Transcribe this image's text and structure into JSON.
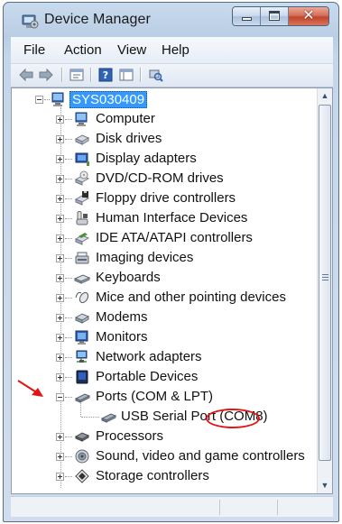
{
  "window": {
    "title": "Device Manager",
    "close_glyph": "✕"
  },
  "menu": [
    "File",
    "Action",
    "View",
    "Help"
  ],
  "toolbar": {
    "icons": [
      "back-icon",
      "forward-icon",
      "properties-icon",
      "help-icon",
      "show-hidden-icon",
      "scan-hardware-icon"
    ]
  },
  "tree": {
    "root": "SYS030409",
    "categories": [
      "Computer",
      "Disk drives",
      "Display adapters",
      "DVD/CD-ROM drives",
      "Floppy drive controllers",
      "Human Interface Devices",
      "IDE ATA/ATAPI controllers",
      "Imaging devices",
      "Keyboards",
      "Mice and other pointing devices",
      "Modems",
      "Monitors",
      "Network adapters",
      "Portable Devices",
      "Ports (COM & LPT)",
      "USB Serial Port (COM8)",
      "Processors",
      "Sound, video and game controllers",
      "Storage controllers"
    ],
    "port_child_prefix": "USB Serial Port ",
    "port_child_highlight": "(COM8)"
  },
  "colors": {
    "selection": "#3399ff",
    "annotation": "#e31414"
  }
}
